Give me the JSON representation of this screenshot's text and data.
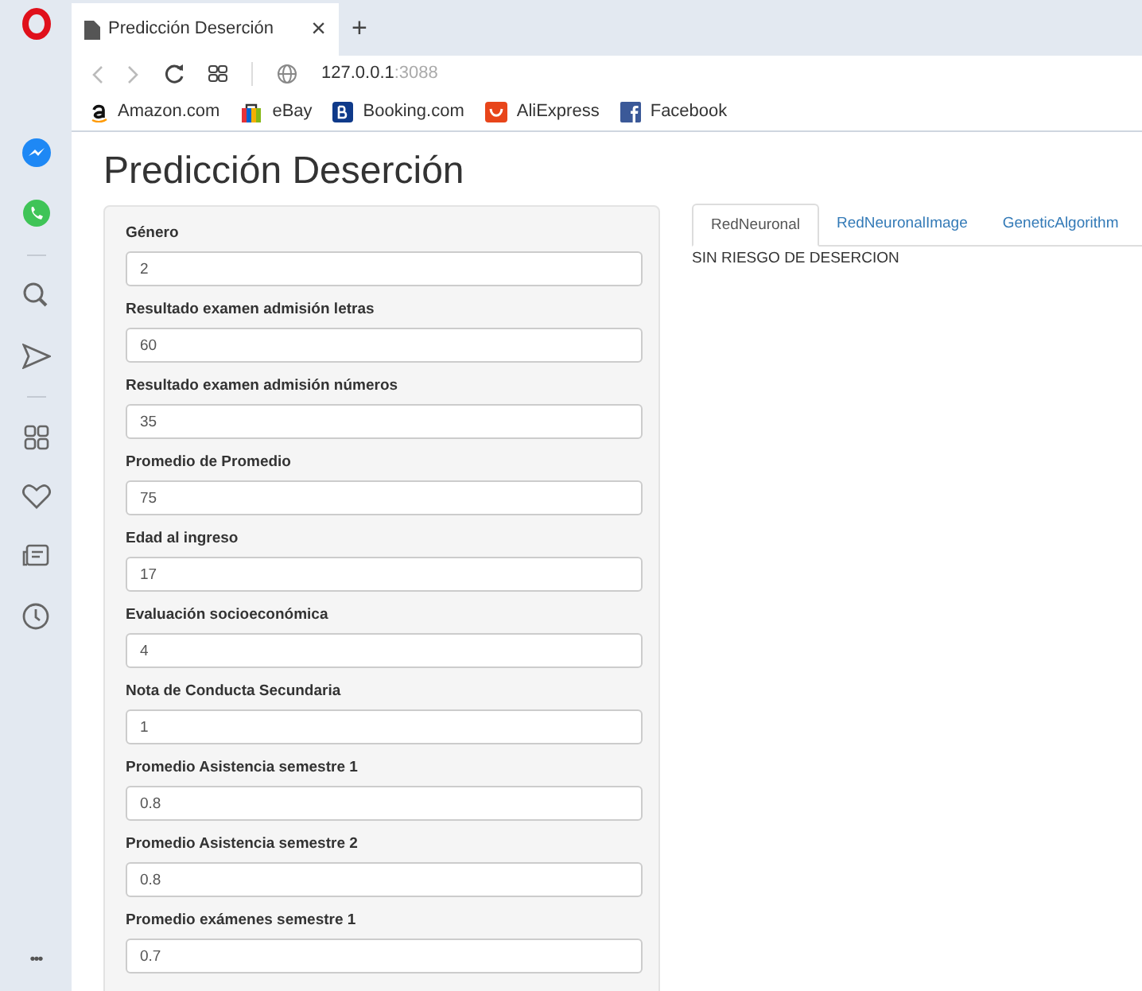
{
  "browser": {
    "tab_title": "Predicción Deserción",
    "tab_close": "×",
    "new_tab": "+",
    "address_host": "127.0.0.1",
    "address_port": ":3088",
    "bookmarks": [
      {
        "label": "Amazon.com",
        "kind": "amazon"
      },
      {
        "label": "eBay",
        "kind": "ebay"
      },
      {
        "label": "Booking.com",
        "kind": "booking"
      },
      {
        "label": "AliExpress",
        "kind": "aliexpress"
      },
      {
        "label": "Facebook",
        "kind": "facebook"
      }
    ],
    "sidebar_more": "•••"
  },
  "page": {
    "title": "Predicción Deserción",
    "fields": [
      {
        "label": "Género",
        "value": "2"
      },
      {
        "label": "Resultado examen admisión letras",
        "value": "60"
      },
      {
        "label": "Resultado examen admisión números",
        "value": "35"
      },
      {
        "label": "Promedio de Promedio",
        "value": "75"
      },
      {
        "label": "Edad al ingreso",
        "value": "17"
      },
      {
        "label": "Evaluación socioeconómica",
        "value": "4"
      },
      {
        "label": "Nota de Conducta Secundaria",
        "value": "1"
      },
      {
        "label": "Promedio Asistencia semestre 1",
        "value": "0.8"
      },
      {
        "label": "Promedio Asistencia semestre 2",
        "value": "0.8"
      },
      {
        "label": "Promedio exámenes semestre 1",
        "value": "0.7"
      }
    ],
    "tabs": [
      {
        "label": "RedNeuronal",
        "selected": true
      },
      {
        "label": "RedNeuronalImage",
        "selected": false
      },
      {
        "label": "GeneticAlgorithm",
        "selected": false
      }
    ],
    "result": "SIN RIESGO DE DESERCION"
  }
}
